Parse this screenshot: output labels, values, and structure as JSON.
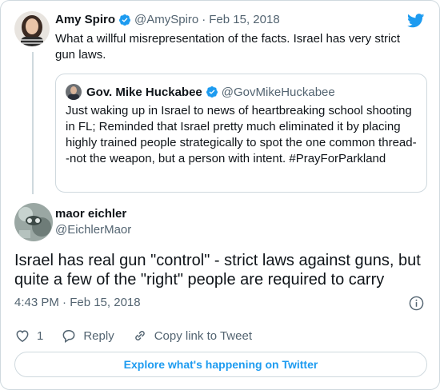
{
  "parent_tweet": {
    "name": "Amy Spiro",
    "handle": "@AmySpiro",
    "separator": "·",
    "date": "Feb 15, 2018",
    "text": "What a willful misrepresentation of the facts. Israel has very strict gun laws."
  },
  "quoted_tweet": {
    "name": "Gov. Mike Huckabee",
    "handle": "@GovMikeHuckabee",
    "text": "Just waking up in Israel to news of heartbreaking school shooting in FL; Reminded that Israel pretty much eliminated it by placing highly trained people strategically to spot the one common thread--not the weapon, but a person with intent. #PrayForParkland"
  },
  "main_tweet": {
    "name": "maor eichler",
    "handle": "@EichlerMaor",
    "text": "Israel has real gun \"control\" - strict laws against guns, but quite a few of the \"right\" people are required to carry",
    "timestamp": "4:43 PM · Feb 15, 2018"
  },
  "actions": {
    "like_count": "1",
    "reply_label": "Reply",
    "copy_link_label": "Copy link to Tweet"
  },
  "footer": {
    "explore_label": "Explore what's happening on Twitter"
  },
  "colors": {
    "accent": "#1d9bf0",
    "text": "#0f1419",
    "muted": "#536471",
    "border": "#cfd9de"
  },
  "icons": [
    "twitter-bird-icon",
    "verified-badge-icon",
    "info-icon",
    "heart-icon",
    "reply-icon",
    "link-icon"
  ]
}
